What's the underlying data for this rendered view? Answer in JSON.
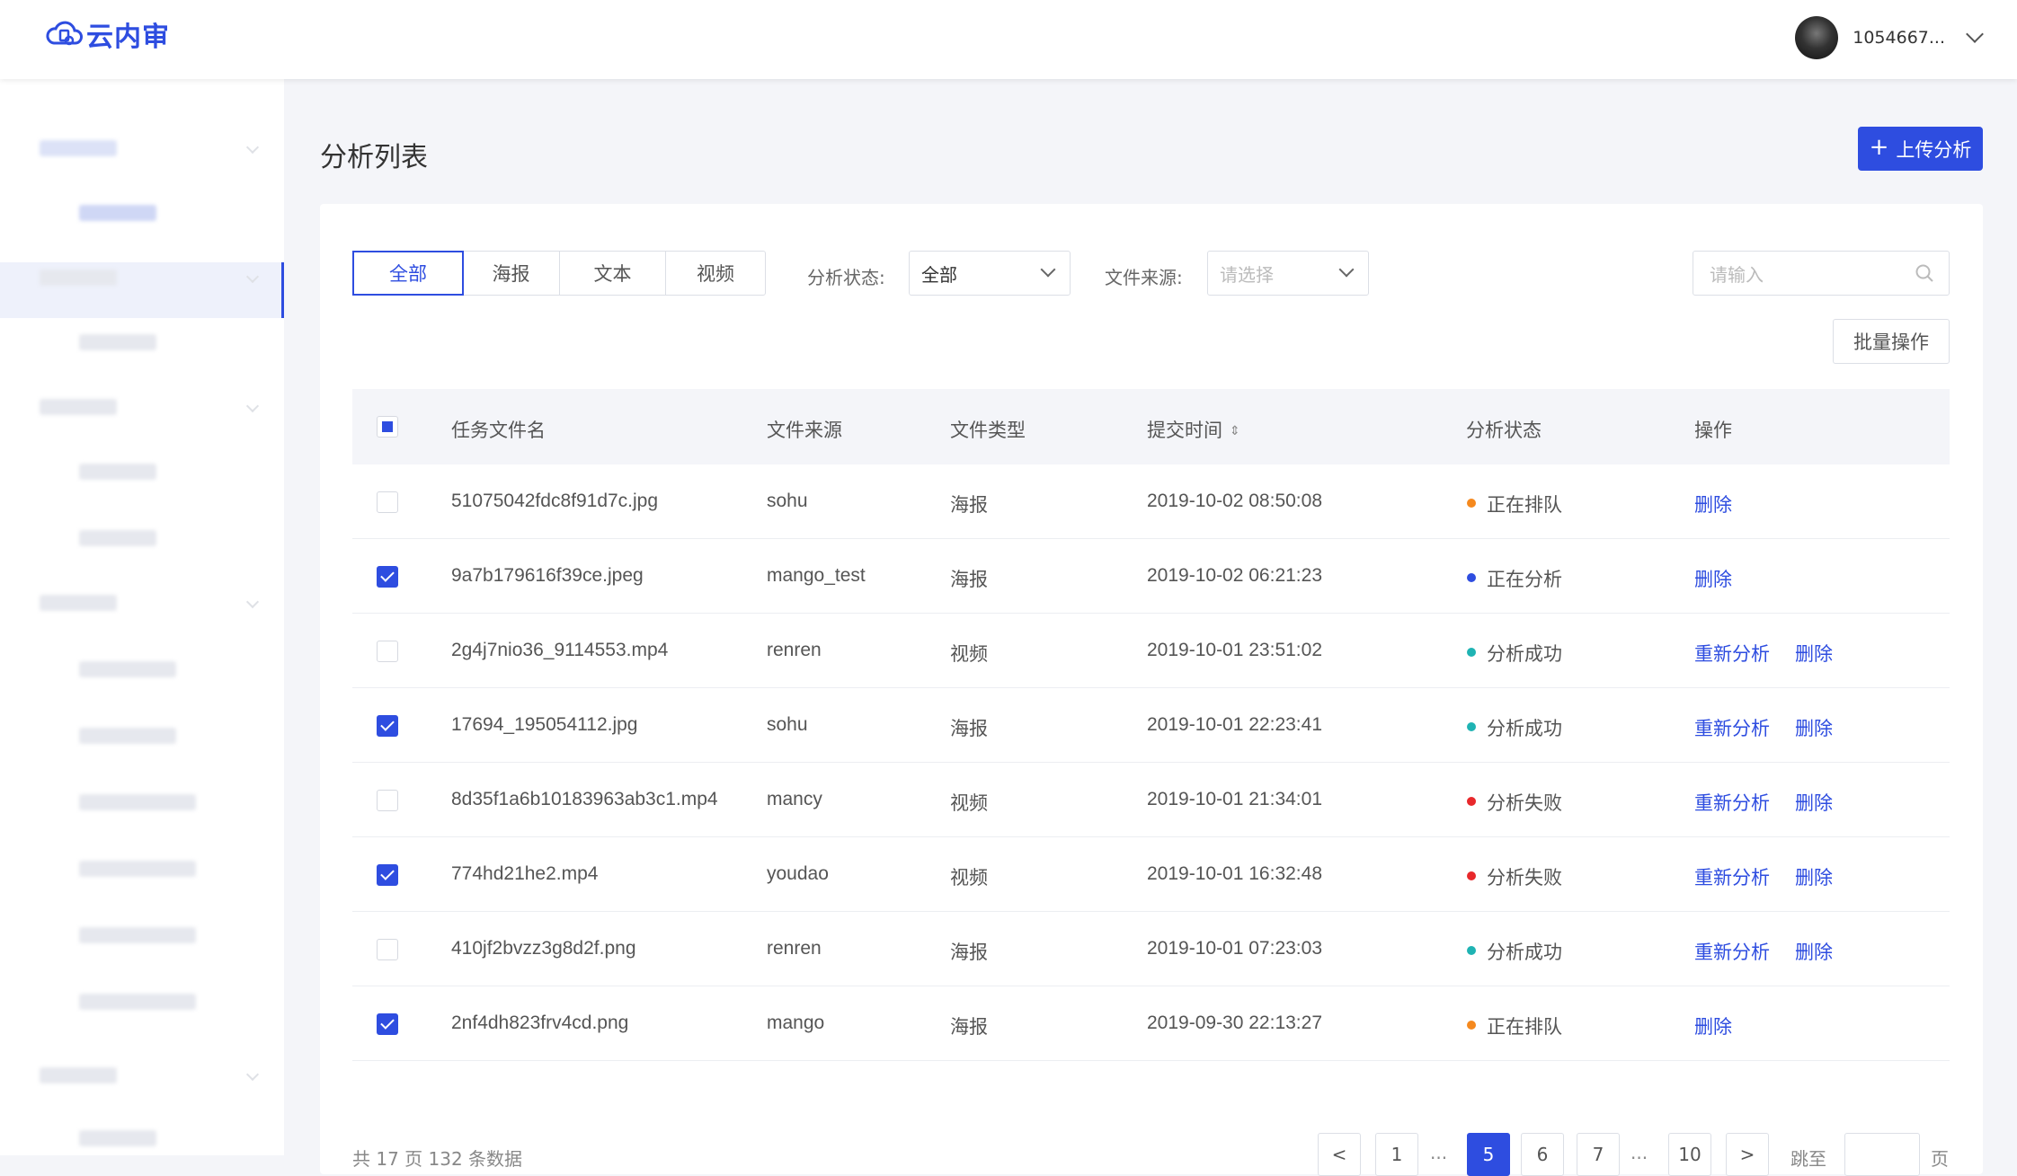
{
  "header": {
    "logo_text": "云内审",
    "username": "1054667..."
  },
  "page": {
    "title": "分析列表",
    "upload_label": "上传分析"
  },
  "filters": {
    "tabs": [
      "全部",
      "海报",
      "文本",
      "视频"
    ],
    "status_label": "分析状态:",
    "status_value": "全部",
    "source_label": "文件来源:",
    "source_placeholder": "请选择",
    "search_placeholder": "请输入",
    "batch_label": "批量操作"
  },
  "table": {
    "columns": [
      "任务文件名",
      "文件来源",
      "文件类型",
      "提交时间",
      "分析状态",
      "操作"
    ],
    "sort_symbol": "⇕",
    "rows": [
      {
        "name": "51075042fdc8f91d7c.jpg",
        "source": "sohu",
        "type": "海报",
        "time": "2019-10-02 08:50:08",
        "status": "正在排队",
        "status_color": "#f5891e",
        "checked": false,
        "actions": [
          "删除"
        ]
      },
      {
        "name": "9a7b179616f39ce.jpeg",
        "source": "mango_test",
        "type": "海报",
        "time": "2019-10-02 06:21:23",
        "status": "正在分析",
        "status_color": "#2e4de0",
        "checked": true,
        "actions": [
          "删除"
        ]
      },
      {
        "name": "2g4j7nio36_9114553.mp4",
        "source": "renren",
        "type": "视频",
        "time": "2019-10-01 23:51:02",
        "status": "分析成功",
        "status_color": "#1fb3b3",
        "checked": false,
        "actions": [
          "重新分析",
          "删除"
        ]
      },
      {
        "name": "17694_195054112.jpg",
        "source": "sohu",
        "type": "海报",
        "time": "2019-10-01 22:23:41",
        "status": "分析成功",
        "status_color": "#1fb3b3",
        "checked": true,
        "actions": [
          "重新分析",
          "删除"
        ]
      },
      {
        "name": "8d35f1a6b10183963ab3c1.mp4",
        "source": "mancy",
        "type": "视频",
        "time": "2019-10-01 21:34:01",
        "status": "分析失败",
        "status_color": "#e8282b",
        "checked": false,
        "actions": [
          "重新分析",
          "删除"
        ]
      },
      {
        "name": "774hd21he2.mp4",
        "source": "youdao",
        "type": "视频",
        "time": "2019-10-01 16:32:48",
        "status": "分析失败",
        "status_color": "#e8282b",
        "checked": true,
        "actions": [
          "重新分析",
          "删除"
        ]
      },
      {
        "name": "410jf2bvzz3g8d2f.png",
        "source": "renren",
        "type": "海报",
        "time": "2019-10-01 07:23:03",
        "status": "分析成功",
        "status_color": "#1fb3b3",
        "checked": false,
        "actions": [
          "重新分析",
          "删除"
        ]
      },
      {
        "name": "2nf4dh823frv4cd.png",
        "source": "mango",
        "type": "海报",
        "time": "2019-09-30 22:13:27",
        "status": "正在排队",
        "status_color": "#f5891e",
        "checked": true,
        "actions": [
          "删除"
        ]
      }
    ]
  },
  "pagination": {
    "summary": "共 17 页 132 条数据",
    "prev": "<",
    "next": ">",
    "pages": [
      "1",
      "5",
      "6",
      "7",
      "10"
    ],
    "current": "5",
    "ellipsis": "...",
    "jump_label": "跳至",
    "page_unit": "页"
  },
  "colors": {
    "accent": "#2e4de0"
  }
}
